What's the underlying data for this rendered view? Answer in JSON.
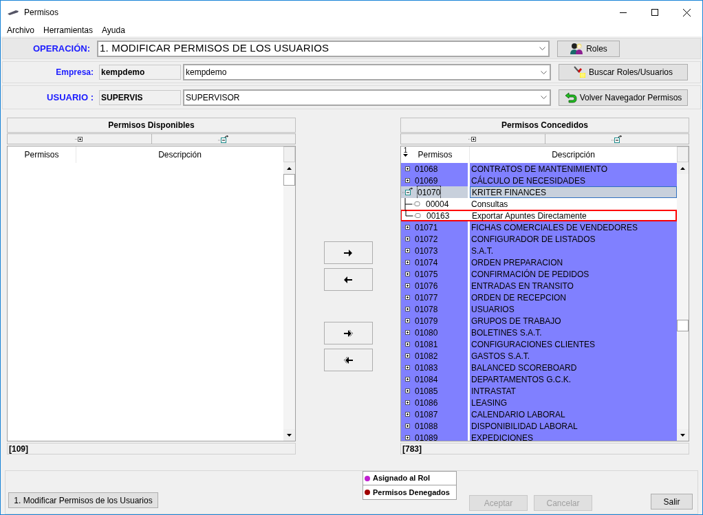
{
  "window": {
    "title": "Permisos"
  },
  "menu": [
    "Archivo",
    "Herramientas",
    "Ayuda"
  ],
  "operation": {
    "label": "OPERACIÓN:",
    "value": "1. MODIFICAR PERMISOS DE LOS USUARIOS",
    "button": "Roles"
  },
  "company": {
    "label": "Empresa:",
    "code": "kempdemo",
    "value": "kempdemo",
    "button": "Buscar Roles/Usuarios"
  },
  "user": {
    "label": "USUARIO :",
    "code": "SUPERVIS",
    "value": "SUPERVISOR",
    "button": "Volver Navegador Permisos"
  },
  "available": {
    "title": "Permisos Disponibles",
    "columns": [
      "Permisos",
      "Descripción"
    ],
    "count": "[109]"
  },
  "granted": {
    "title": "Permisos Concedidos",
    "sort_indicator": "1",
    "columns": [
      "Permisos",
      "Descripción"
    ],
    "count": "[783]",
    "rows": [
      {
        "code": "01068",
        "description": "CONTRATOS DE MANTENIMIENTO",
        "expanded": false,
        "selected": false
      },
      {
        "code": "01069",
        "description": "CÁLCULO DE NECESIDADES",
        "expanded": false,
        "selected": false
      },
      {
        "code": "01070",
        "description": "KRITER FINANCES",
        "expanded": true,
        "selected": true,
        "children": [
          {
            "code": "00004",
            "description": "Consultas",
            "highlighted": false
          },
          {
            "code": "00163",
            "description": "Exportar Apuntes Directamente",
            "highlighted": true
          }
        ]
      },
      {
        "code": "01071",
        "description": "FICHAS COMERCIALES DE VENDEDORES",
        "expanded": false,
        "selected": false
      },
      {
        "code": "01072",
        "description": "CONFIGURADOR DE LISTADOS",
        "expanded": false,
        "selected": false
      },
      {
        "code": "01073",
        "description": "S.A.T.",
        "expanded": false,
        "selected": false
      },
      {
        "code": "01074",
        "description": "ORDEN PREPARACION",
        "expanded": false,
        "selected": false
      },
      {
        "code": "01075",
        "description": "CONFIRMACIÓN DE PEDIDOS",
        "expanded": false,
        "selected": false
      },
      {
        "code": "01076",
        "description": "ENTRADAS EN TRANSITO",
        "expanded": false,
        "selected": false
      },
      {
        "code": "01077",
        "description": "ORDEN DE RECEPCION",
        "expanded": false,
        "selected": false
      },
      {
        "code": "01078",
        "description": "USUARIOS",
        "expanded": false,
        "selected": false
      },
      {
        "code": "01079",
        "description": "GRUPOS DE TRABAJO",
        "expanded": false,
        "selected": false
      },
      {
        "code": "01080",
        "description": "BOLETINES S.A.T.",
        "expanded": false,
        "selected": false
      },
      {
        "code": "01081",
        "description": "CONFIGURACIONES CLIENTES",
        "expanded": false,
        "selected": false
      },
      {
        "code": "01082",
        "description": "GASTOS S.A.T.",
        "expanded": false,
        "selected": false
      },
      {
        "code": "01083",
        "description": "BALANCED SCOREBOARD",
        "expanded": false,
        "selected": false
      },
      {
        "code": "01084",
        "description": "DEPARTAMENTOS G.C.K.",
        "expanded": false,
        "selected": false
      },
      {
        "code": "01085",
        "description": "INTRASTAT",
        "expanded": false,
        "selected": false
      },
      {
        "code": "01086",
        "description": "LEASING",
        "expanded": false,
        "selected": false
      },
      {
        "code": "01087",
        "description": "CALENDARIO LABORAL",
        "expanded": false,
        "selected": false
      },
      {
        "code": "01088",
        "description": "DISPONIBILIDAD LABORAL",
        "expanded": false,
        "selected": false
      },
      {
        "code": "01089",
        "description": "EXPEDICIONES",
        "expanded": false,
        "selected": false
      }
    ]
  },
  "legend": [
    {
      "label": "Asignado al Rol",
      "color": "#c020d0"
    },
    {
      "label": "Permisos Denegados",
      "color": "#a00000"
    }
  ],
  "buttons": [
    {
      "label": "1. Modificar Permisos de los Usuarios",
      "disabled": false
    },
    {
      "label": "Aceptar",
      "disabled": true
    },
    {
      "label": "Cancelar",
      "disabled": true
    },
    {
      "label": "Salir",
      "disabled": false
    }
  ]
}
